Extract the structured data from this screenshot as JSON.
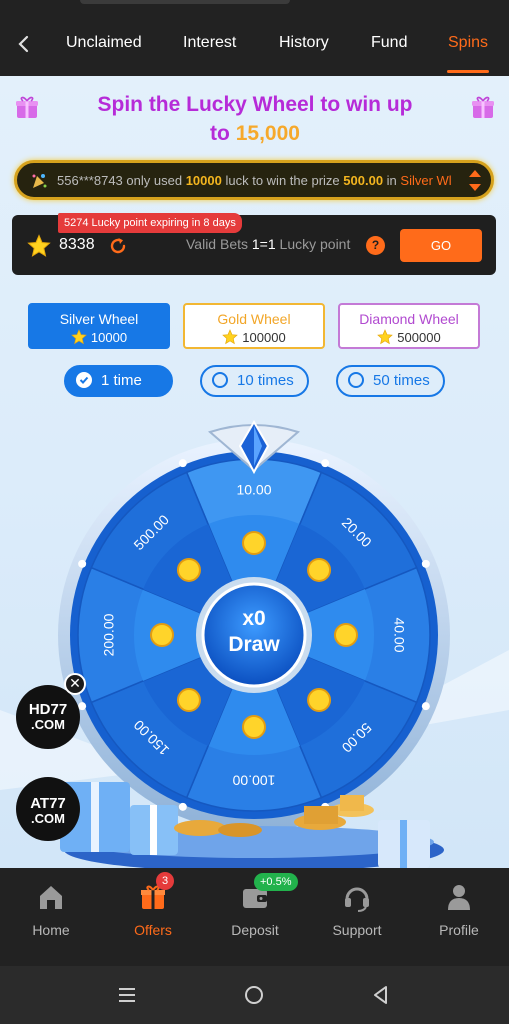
{
  "tabs": [
    "Unclaimed",
    "Interest",
    "History",
    "Fund",
    "Spins"
  ],
  "active_tab": "Spins",
  "headline": {
    "line1": "Spin the Lucky Wheel to win up",
    "prefix": "to",
    "amount": "15,000"
  },
  "marquee": {
    "user": "556***8743",
    "mid1": "only used",
    "luck": "10000",
    "mid2": "luck to win the prize",
    "prize": "500.00",
    "mid3": "in",
    "wheel": "Silver Wl"
  },
  "lucky": {
    "expire_note": "5274 Lucky point expiring in 8 days",
    "points": "8338",
    "valid_label": "Valid Bets",
    "ratio": "1=1",
    "unit": "Lucky point",
    "help": "?",
    "go_label": "GO"
  },
  "wheels": [
    {
      "name": "Silver Wheel",
      "cost": "10000"
    },
    {
      "name": "Gold Wheel",
      "cost": "100000"
    },
    {
      "name": "Diamond Wheel",
      "cost": "500000"
    }
  ],
  "times": [
    "1 time",
    "10 times",
    "50 times"
  ],
  "wheel": {
    "segments": [
      "10.00",
      "20.00",
      "40.00",
      "50.00",
      "100.00",
      "150.00",
      "200.00",
      "500.00"
    ],
    "center_count": "x0",
    "center_label": "Draw"
  },
  "floating": [
    {
      "line1": "HD77",
      "line2": ".COM"
    },
    {
      "line1": "AT77",
      "line2": ".COM"
    }
  ],
  "nav": [
    {
      "label": "Home",
      "icon": "home-icon"
    },
    {
      "label": "Offers",
      "icon": "gift-icon",
      "badge": "3"
    },
    {
      "label": "Deposit",
      "icon": "wallet-icon",
      "badge": "+0.5%"
    },
    {
      "label": "Support",
      "icon": "headset-icon"
    },
    {
      "label": "Profile",
      "icon": "profile-icon"
    }
  ],
  "colors": {
    "accent": "#ff6b1a",
    "blue": "#1778e6",
    "purple": "#b62bd8",
    "gold": "#f6a92b"
  }
}
